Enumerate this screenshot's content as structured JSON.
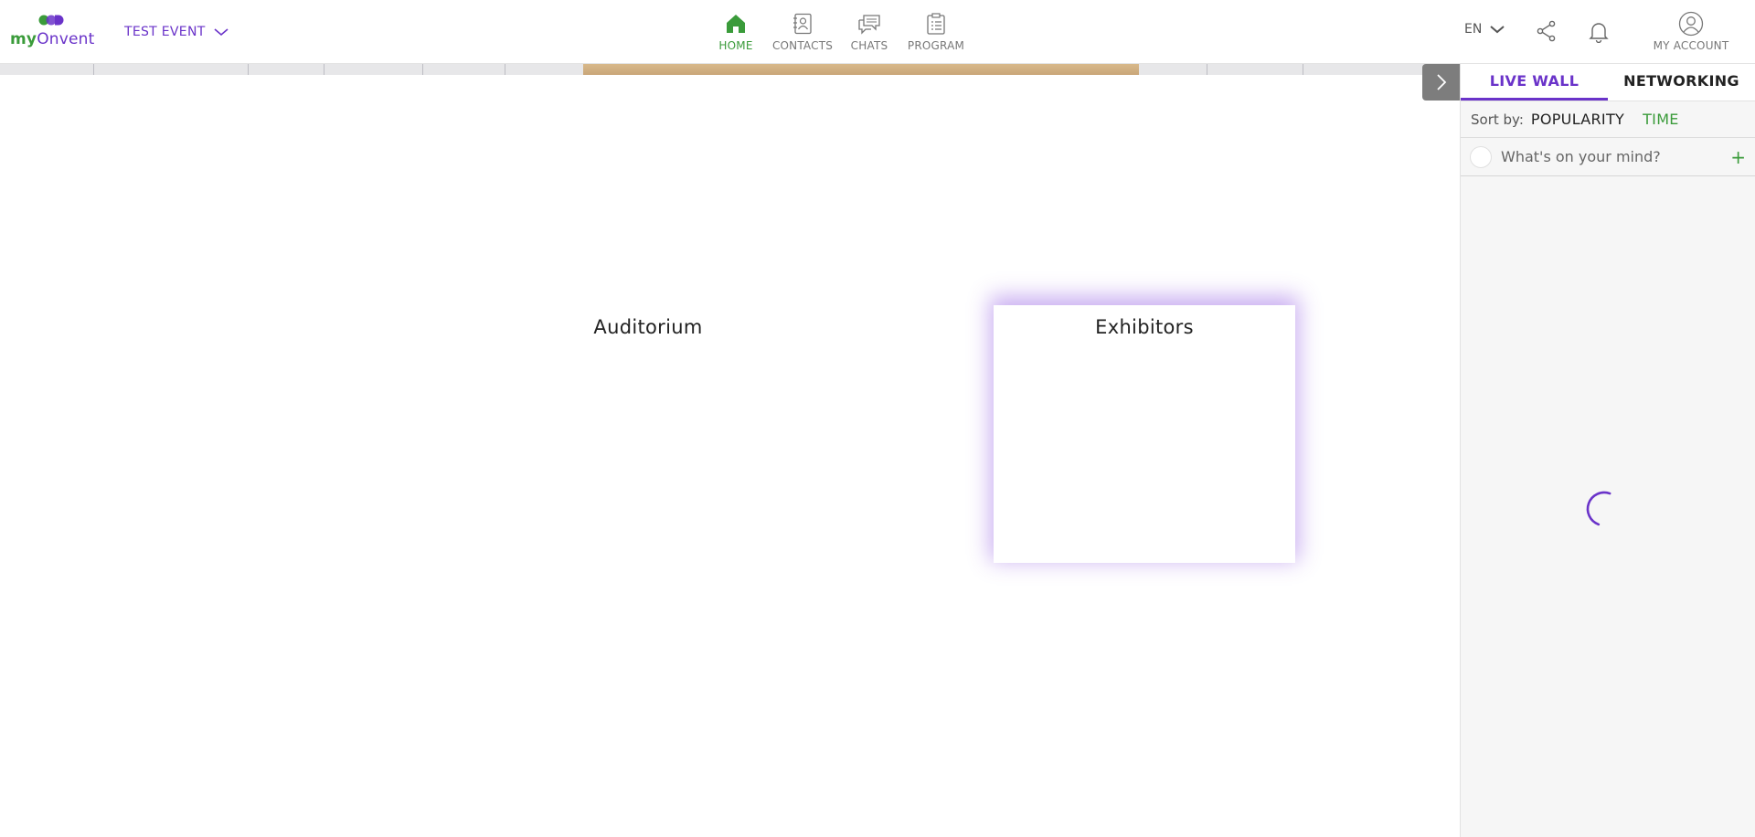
{
  "brand": {
    "my": "my",
    "onvent": "Onvent",
    "primary_color": "#6a33c9",
    "accent_color": "#3a9b3a"
  },
  "event_selector": {
    "label": "TEST EVENT"
  },
  "nav": [
    {
      "label": "HOME",
      "icon": "home-icon",
      "active": true
    },
    {
      "label": "CONTACTS",
      "icon": "contacts-icon",
      "active": false
    },
    {
      "label": "CHATS",
      "icon": "chats-icon",
      "active": false
    },
    {
      "label": "PROGRAM",
      "icon": "program-icon",
      "active": false
    }
  ],
  "toolbar": {
    "language": "EN",
    "account_label": "MY ACCOUNT"
  },
  "rooms": [
    {
      "title": "Auditorium"
    },
    {
      "title": "Exhibitors",
      "highlighted": true
    }
  ],
  "panel": {
    "tabs": [
      {
        "label": "LIVE WALL",
        "active": true
      },
      {
        "label": "NETWORKING",
        "active": false
      }
    ],
    "sort": {
      "label": "Sort by:",
      "options": [
        "POPULARITY",
        "TIME"
      ],
      "selected": "TIME"
    },
    "compose": {
      "placeholder": "What's on your mind?"
    }
  }
}
